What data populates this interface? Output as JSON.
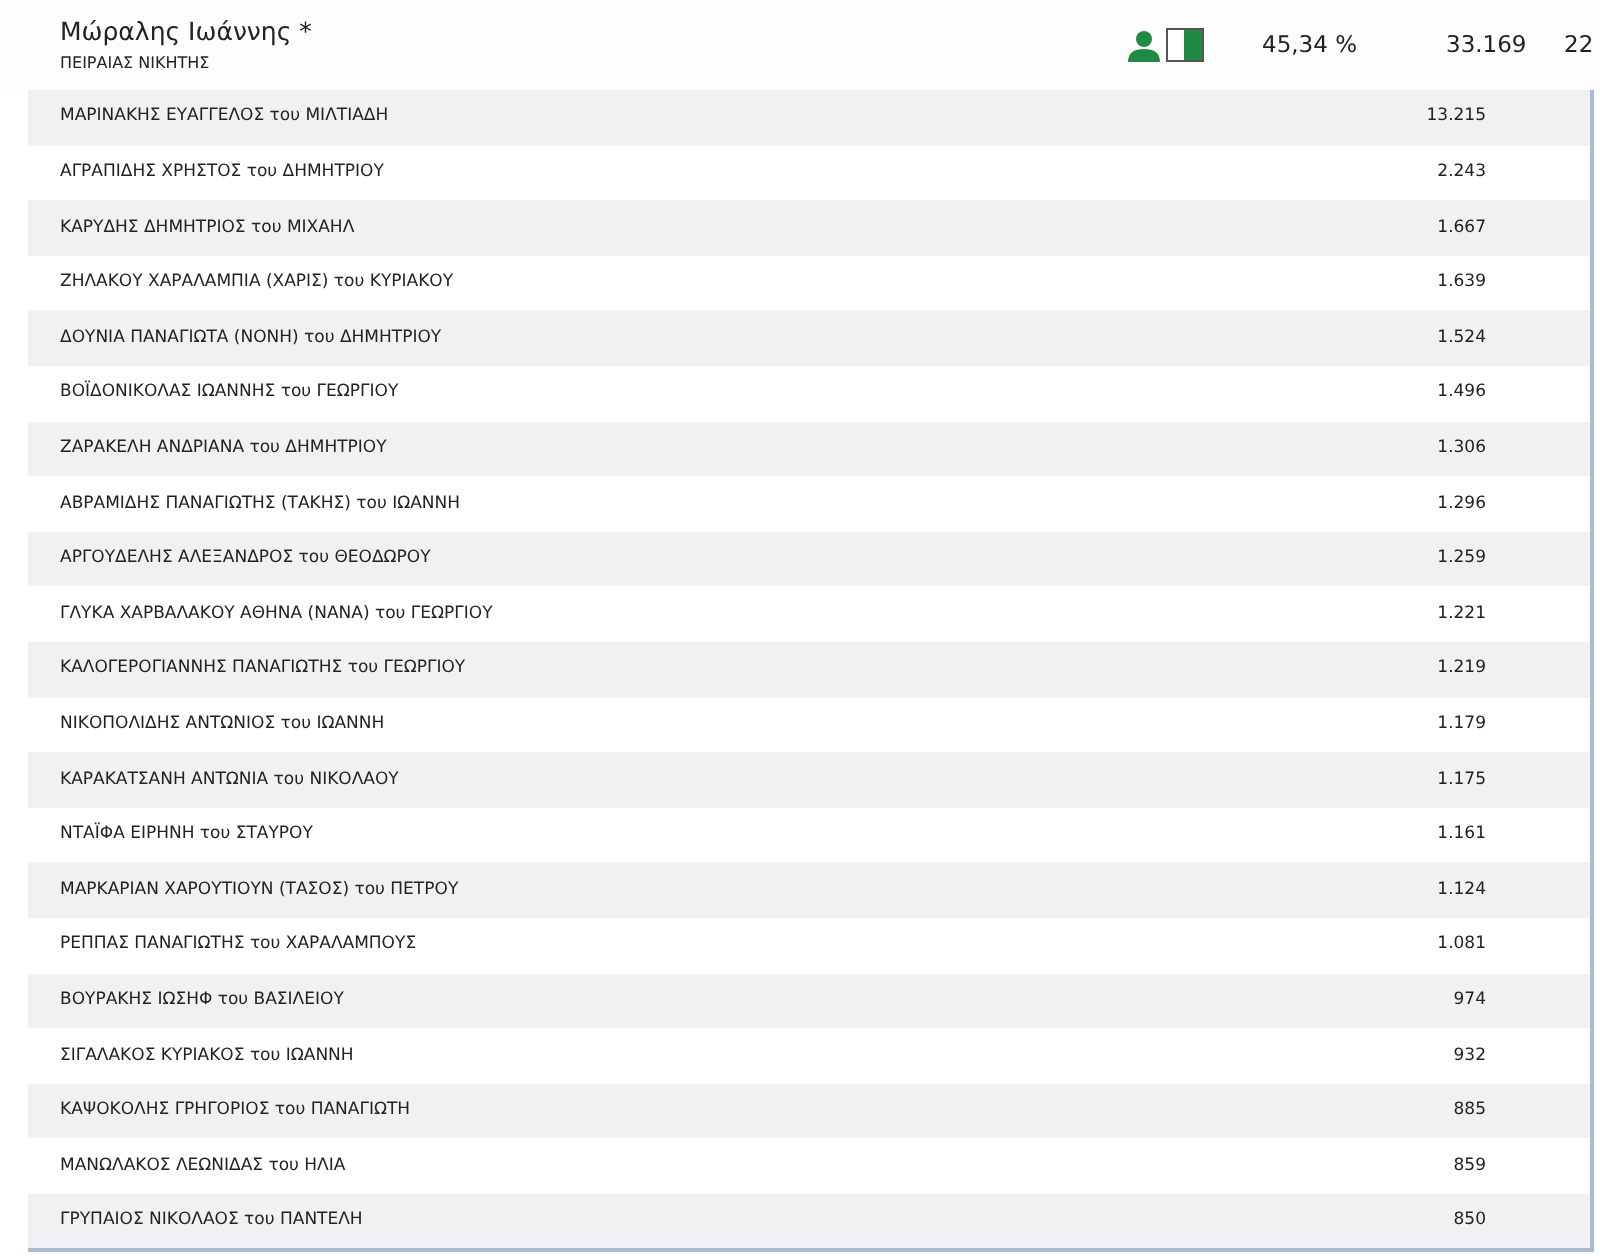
{
  "header": {
    "name": "Μώραλης Ιωάννης *",
    "party": "ΠΕΙΡΑΙΑΣ ΝΙΚΗΤΗΣ",
    "percent": "45,34 %",
    "votes": "33.169",
    "seats": "22"
  },
  "candidates": [
    {
      "name": "ΜΑΡΙΝΑΚΗΣ ΕΥΑΓΓΕΛΟΣ του ΜΙΛΤΙΑΔΗ",
      "votes": "13.215"
    },
    {
      "name": "ΑΓΡΑΠΙΔΗΣ ΧΡΗΣΤΟΣ του ΔΗΜΗΤΡΙΟΥ",
      "votes": "2.243"
    },
    {
      "name": "ΚΑΡΥΔΗΣ ΔΗΜΗΤΡΙΟΣ του ΜΙΧΑΗΛ",
      "votes": "1.667"
    },
    {
      "name": "ΖΗΛΑΚΟΥ ΧΑΡΑΛΑΜΠΙΑ (ΧΑΡΙΣ) του ΚΥΡΙΑΚΟΥ",
      "votes": "1.639"
    },
    {
      "name": "ΔΟΥΝΙΑ ΠΑΝΑΓΙΩΤΑ (ΝΟΝΗ) του ΔΗΜΗΤΡΙΟΥ",
      "votes": "1.524"
    },
    {
      "name": "ΒΟΪΔΟΝΙΚΟΛΑΣ ΙΩΑΝΝΗΣ του ΓΕΩΡΓΙΟΥ",
      "votes": "1.496"
    },
    {
      "name": "ΖΑΡΑΚΕΛΗ ΑΝΔΡΙΑΝΑ του ΔΗΜΗΤΡΙΟΥ",
      "votes": "1.306"
    },
    {
      "name": "ΑΒΡΑΜΙΔΗΣ ΠΑΝΑΓΙΩΤΗΣ (ΤΑΚΗΣ) του ΙΩΑΝΝΗ",
      "votes": "1.296"
    },
    {
      "name": "ΑΡΓΟΥΔΕΛΗΣ ΑΛΕΞΑΝΔΡΟΣ του ΘΕΟΔΩΡΟΥ",
      "votes": "1.259"
    },
    {
      "name": "ΓΛΥΚΑ ΧΑΡΒΑΛΑΚΟΥ ΑΘΗΝΑ (ΝΑΝΑ) του ΓΕΩΡΓΙΟΥ",
      "votes": "1.221"
    },
    {
      "name": "ΚΑΛΟΓΕΡΟΓΙΑΝΝΗΣ ΠΑΝΑΓΙΩΤΗΣ του ΓΕΩΡΓΙΟΥ",
      "votes": "1.219"
    },
    {
      "name": "ΝΙΚΟΠΟΛΙΔΗΣ ΑΝΤΩΝΙΟΣ του ΙΩΑΝΝΗ",
      "votes": "1.179"
    },
    {
      "name": "ΚΑΡΑΚΑΤΣΑΝΗ ΑΝΤΩΝΙΑ του ΝΙΚΟΛΑΟΥ",
      "votes": "1.175"
    },
    {
      "name": "ΝΤΑΪΦΑ ΕΙΡΗΝΗ του ΣΤΑΥΡΟΥ",
      "votes": "1.161"
    },
    {
      "name": "ΜΑΡΚΑΡΙΑΝ ΧΑΡΟΥΤΙΟΥΝ (ΤΑΣΟΣ) του ΠΕΤΡΟΥ",
      "votes": "1.124"
    },
    {
      "name": "ΡΕΠΠΑΣ ΠΑΝΑΓΙΩΤΗΣ του ΧΑΡΑΛΑΜΠΟΥΣ",
      "votes": "1.081"
    },
    {
      "name": "ΒΟΥΡΑΚΗΣ ΙΩΣΗΦ του ΒΑΣΙΛΕΙΟΥ",
      "votes": "974"
    },
    {
      "name": "ΣΙΓΑΛΑΚΟΣ ΚΥΡΙΑΚΟΣ του ΙΩΑΝΝΗ",
      "votes": "932"
    },
    {
      "name": "ΚΑΨΟΚΟΛΗΣ ΓΡΗΓΟΡΙΟΣ του ΠΑΝΑΓΙΩΤΗ",
      "votes": "885"
    },
    {
      "name": "ΜΑΝΩΛΑΚΟΣ ΛΕΩΝΙΔΑΣ του ΗΛΙΑ",
      "votes": "859"
    },
    {
      "name": "ΓΡΥΠΑΙΟΣ ΝΙΚΟΛΑΟΣ του ΠΑΝΤΕΛΗ",
      "votes": "850"
    }
  ]
}
